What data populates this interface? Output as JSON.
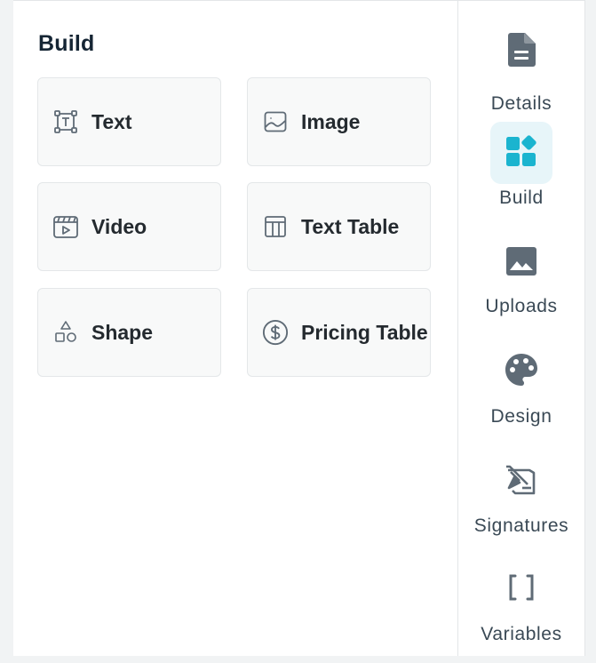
{
  "panel": {
    "title": "Build",
    "tiles": [
      {
        "label": "Text",
        "icon": "text-box-icon"
      },
      {
        "label": "Image",
        "icon": "image-icon"
      },
      {
        "label": "Video",
        "icon": "video-icon"
      },
      {
        "label": "Text Table",
        "icon": "table-icon"
      },
      {
        "label": "Shape",
        "icon": "shapes-icon"
      },
      {
        "label": "Pricing Table",
        "icon": "dollar-circle-icon"
      }
    ]
  },
  "rail": {
    "items": [
      {
        "label": "Details",
        "icon": "document-icon",
        "active": false
      },
      {
        "label": "Build",
        "icon": "widgets-icon",
        "active": true
      },
      {
        "label": "Uploads",
        "icon": "image-icon",
        "active": false
      },
      {
        "label": "Design",
        "icon": "palette-icon",
        "active": false
      },
      {
        "label": "Signatures",
        "icon": "signature-icon",
        "active": false
      },
      {
        "label": "Variables",
        "icon": "brackets-icon",
        "active": false
      }
    ]
  },
  "colors": {
    "accent": "#1bb4cf",
    "active_bg": "#e7f5f9",
    "icon_gray": "#5f6b76",
    "text_dark": "#242a2f"
  }
}
